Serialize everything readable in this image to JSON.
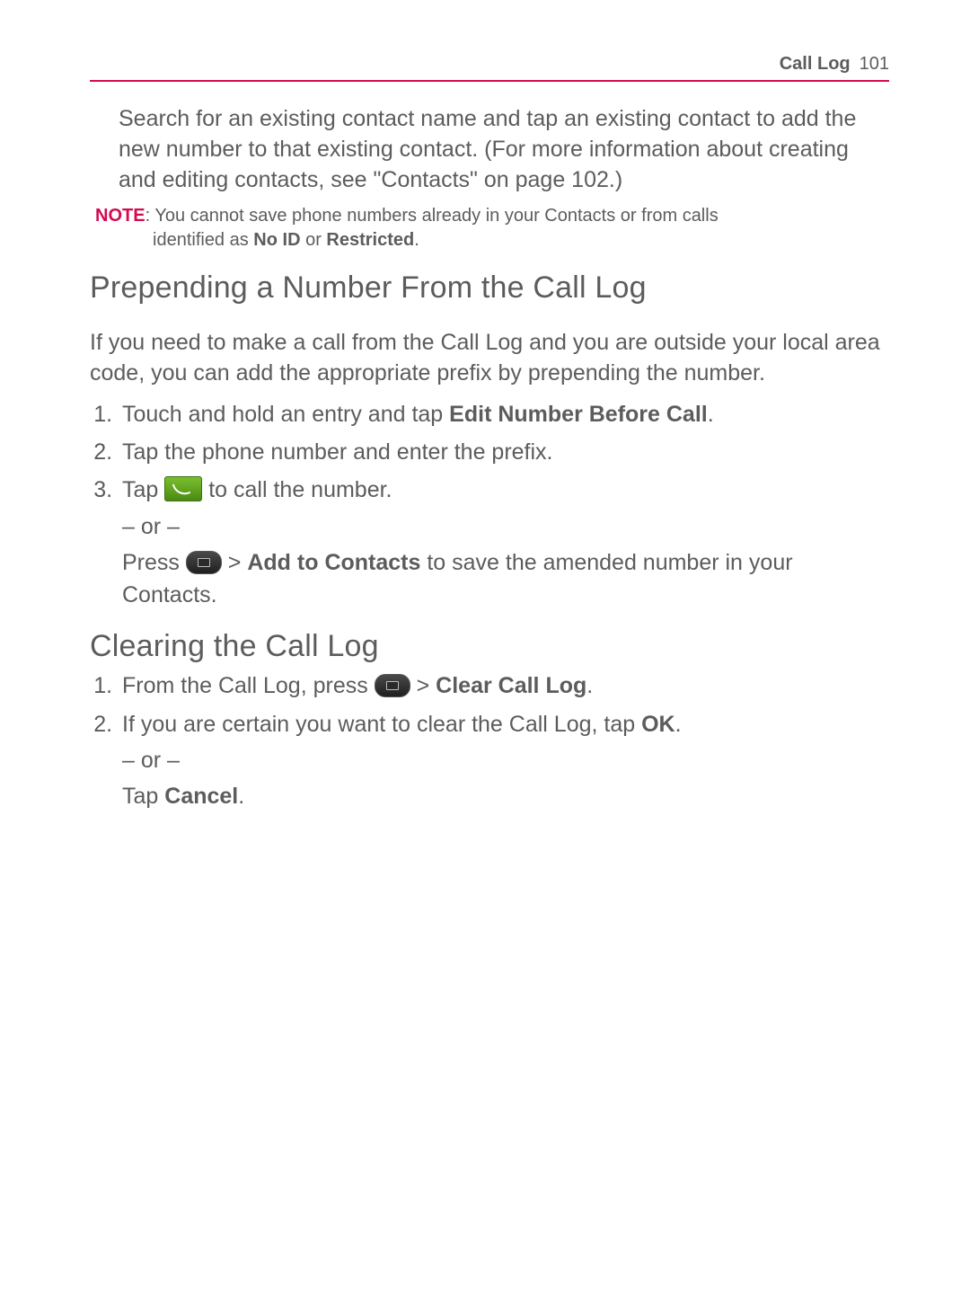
{
  "header": {
    "section": "Call Log",
    "page_number": "101"
  },
  "intro": {
    "paragraph": "Search for an existing contact name and tap an existing contact to add the new number to that existing contact. (For more information about creating and editing contacts, see \"Contacts\" on page 102.)"
  },
  "note": {
    "label": "NOTE",
    "line1": ": You cannot save phone numbers already in your Contacts or from calls",
    "line2_prefix": "identified as ",
    "noid": "No ID",
    "or": " or ",
    "restricted": "Restricted",
    "period": "."
  },
  "section_prepend": {
    "heading": "Prepending a Number From the Call Log",
    "intro": "If you need to make a call from the Call Log and you are outside your local area code, you can add the appropriate prefix by prepending the number.",
    "steps": {
      "s1_prefix": "Touch and hold an entry and tap ",
      "s1_bold": "Edit Number Before Call",
      "s1_suffix": ".",
      "s2": "Tap the phone number and enter the prefix.",
      "s3_prefix": "Tap ",
      "s3_suffix": " to call the number.",
      "or": "– or –",
      "press_prefix": "Press ",
      "gt": " > ",
      "add_to_contacts": "Add to Contacts",
      "press_suffix": " to save the amended number in your Contacts."
    }
  },
  "section_clear": {
    "heading": "Clearing the Call Log",
    "steps": {
      "s1_prefix": "From the Call Log, press ",
      "gt": " > ",
      "clear_call_log": "Clear Call Log",
      "s1_suffix": ".",
      "s2_prefix": "If you are certain you want to clear the Call Log, tap ",
      "ok": "OK",
      "s2_suffix": ".",
      "or": "– or –",
      "tap_prefix": "Tap ",
      "cancel": "Cancel",
      "tap_suffix": "."
    }
  }
}
